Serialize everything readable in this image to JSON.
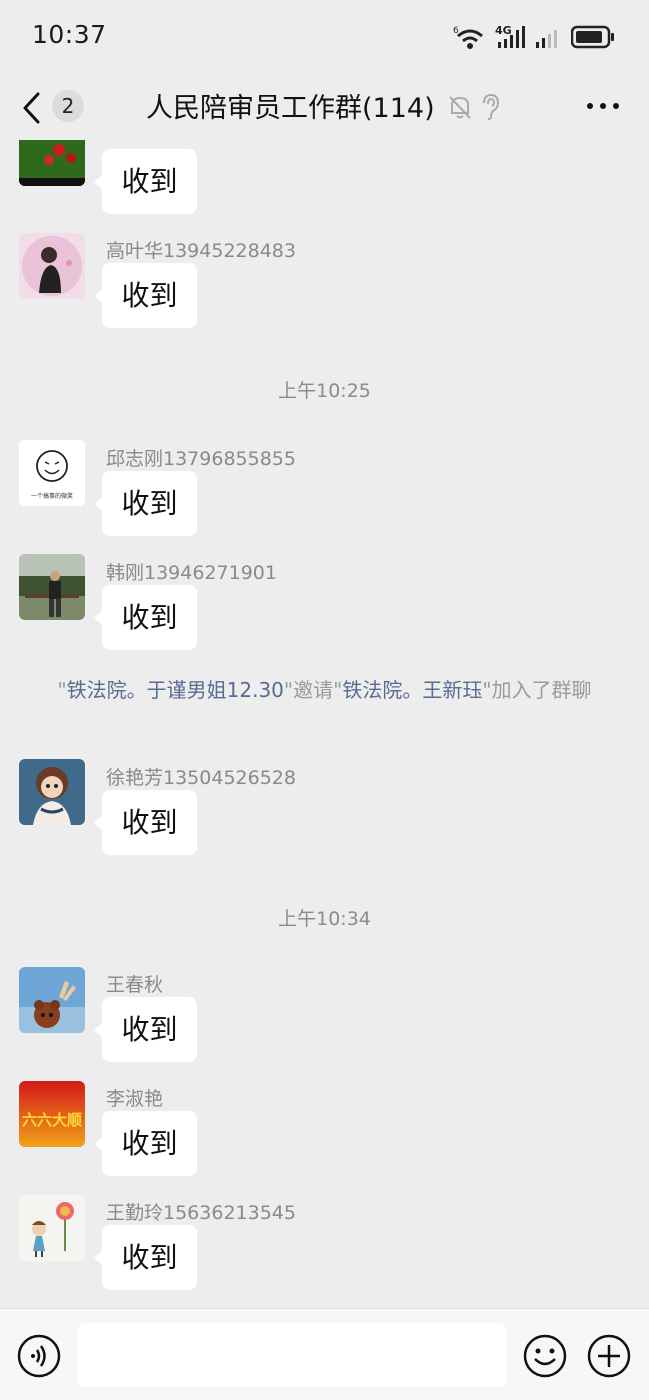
{
  "status_bar": {
    "time": "10:37",
    "icons": [
      "wifi-icon",
      "signal-4g-icon",
      "signal-icon",
      "battery-icon"
    ],
    "network_badge_top": "6",
    "network_badge": "4G"
  },
  "header": {
    "back_icon": "chevron-left-icon",
    "unread_count": "2",
    "title": "人民陪审员工作群(114)",
    "icons": [
      "mute-bell-icon",
      "ear-icon",
      "more-icon"
    ]
  },
  "messages": [
    {
      "sender": "",
      "text": "收到",
      "avatar": "red-berries-photo"
    },
    {
      "sender": "高叶华13945228483",
      "text": "收到",
      "avatar": "girl-illustration-pink"
    },
    {
      "sender": "邱志刚13796855855",
      "text": "收到",
      "avatar": "smiley-sketch",
      "avatar_caption": "一个搞事的微笑"
    },
    {
      "sender": "韩刚13946271901",
      "text": "收到",
      "avatar": "man-outdoor-photo"
    },
    {
      "sender": "徐艳芳13504526528",
      "text": "收到",
      "avatar": "doll-portrait"
    },
    {
      "sender": "王春秋",
      "text": "收到",
      "avatar": "bear-sky-photo"
    },
    {
      "sender": "李淑艳",
      "text": "收到",
      "avatar": "liu-liu-da-shun-calligraphy",
      "avatar_text": "六六大顺"
    },
    {
      "sender": "王勤玲15636213545",
      "text": "收到",
      "avatar": "cartoon-girl-lollipop"
    }
  ],
  "timestamps": [
    "上午10:25",
    "上午10:34"
  ],
  "system_message": {
    "q1": "\"",
    "inviter": "铁法院。于谨男姐12.30",
    "mid": "\"邀请\"",
    "invitee": "铁法院。王新珏",
    "end": "\"加入了群聊"
  },
  "input_bar": {
    "placeholder": "",
    "icons": [
      "voice-icon",
      "emoji-icon",
      "plus-icon"
    ]
  },
  "colors": {
    "background": "#ededed",
    "bubble": "#ffffff",
    "link": "#576b95",
    "meta_text": "#8a8a8a"
  }
}
